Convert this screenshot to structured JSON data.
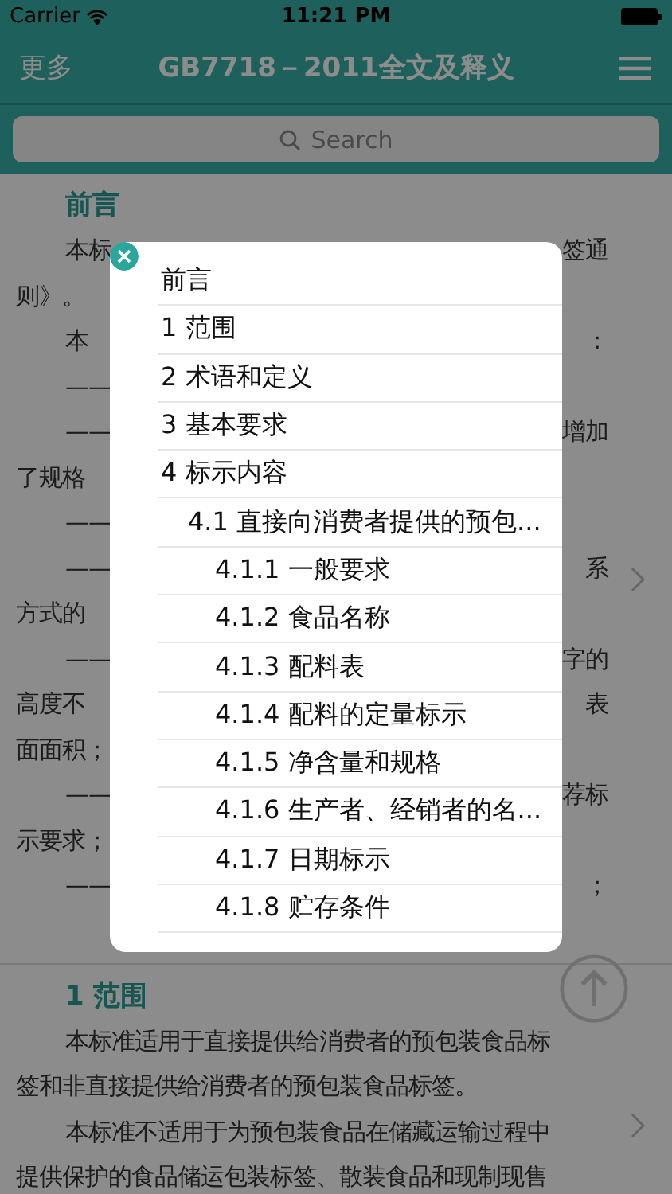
{
  "status_bar": {
    "carrier": "Carrier",
    "time": "11:21 PM"
  },
  "nav": {
    "left": "更多",
    "title": "GB7718－2011全文及释义"
  },
  "search": {
    "placeholder": "Search"
  },
  "sections": [
    {
      "heading": "前言",
      "lines": [
        {
          "kind": "first",
          "left": "本标",
          "right": "签通"
        },
        {
          "kind": "cont",
          "left": "则》。"
        },
        {
          "kind": "first",
          "left": "本",
          "right": "："
        },
        {
          "kind": "first",
          "left": "——"
        },
        {
          "kind": "first",
          "left": "——",
          "right": "增加"
        },
        {
          "kind": "cont",
          "left": "了规格"
        },
        {
          "kind": "first",
          "left": "——"
        },
        {
          "kind": "first",
          "left": "——",
          "right": "系"
        },
        {
          "kind": "cont",
          "left": "方式的"
        },
        {
          "kind": "first",
          "left": "——",
          "right": "字的"
        },
        {
          "kind": "cont",
          "left": "高度不",
          "right": "表"
        },
        {
          "kind": "cont",
          "left": "面面积；"
        },
        {
          "kind": "first",
          "left": "——",
          "right": "荐标"
        },
        {
          "kind": "cont",
          "left": "示要求；"
        },
        {
          "kind": "first",
          "left": "——",
          "right": "；"
        }
      ]
    },
    {
      "heading": "1 范围",
      "lines": [
        {
          "kind": "first",
          "left": "本标准适用于直接提供给消费者的预包装食品标"
        },
        {
          "kind": "cont",
          "left": "签和非直接提供给消费者的预包装食品标签。"
        },
        {
          "kind": "first",
          "left": "本标准不适用于为预包装食品在储藏运输过程中"
        },
        {
          "kind": "cont",
          "left": "提供保护的食品储运包装标签、散装食品和现制现售"
        }
      ]
    }
  ],
  "toc": [
    {
      "label": "前言"
    },
    {
      "label": "1 范围"
    },
    {
      "label": "2 术语和定义"
    },
    {
      "label": "3 基本要求"
    },
    {
      "label": "4 标示内容",
      "children": [
        {
          "label": "4.1 直接向消费者提供的预包...",
          "children": [
            {
              "label": "4.1.1 一般要求"
            },
            {
              "label": "4.1.2 食品名称"
            },
            {
              "label": "4.1.3 配料表"
            },
            {
              "label": "4.1.4 配料的定量标示"
            },
            {
              "label": "4.1.5 净含量和规格"
            },
            {
              "label": "4.1.6 生产者、经销者的名..."
            },
            {
              "label": "4.1.7 日期标示"
            },
            {
              "label": "4.1.8 贮存条件"
            }
          ]
        }
      ]
    }
  ]
}
